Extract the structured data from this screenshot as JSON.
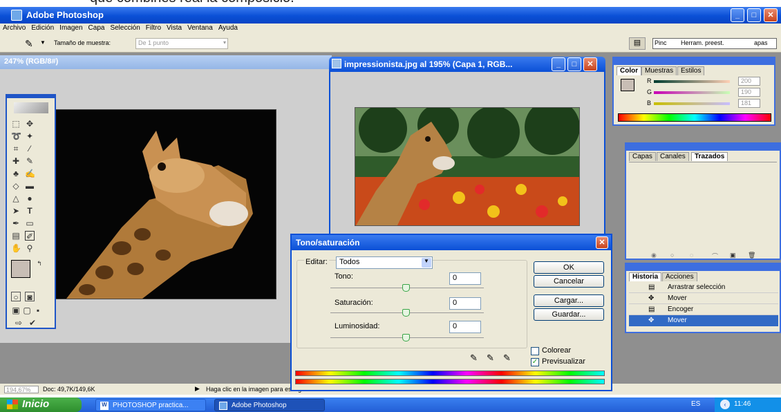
{
  "caption": "que combinés real la composició.",
  "app": {
    "title": "Adobe Photoshop"
  },
  "menu": [
    "Archivo",
    "Edición",
    "Imagen",
    "Capa",
    "Selección",
    "Filtro",
    "Vista",
    "Ventana",
    "Ayuda"
  ],
  "options": {
    "sample_label": "Tamaño de muestra:",
    "sample_value": "De 1 punto",
    "tabs": [
      "Pinc",
      "Herram. preest.",
      "apas"
    ]
  },
  "doc1": {
    "title": "247% (RGB/8#)"
  },
  "doc2": {
    "title": "impressionista.jpg al 195% (Capa 1, RGB..."
  },
  "status": {
    "zoom": "194,67%",
    "doc": "Doc: 49,7K/149,6K",
    "hint": "Haga clic en la imagen para escoger un color nuevo."
  },
  "color_panel": {
    "tabs": [
      "Color",
      "Muestras",
      "Estilos"
    ],
    "channels": [
      {
        "label": "R",
        "value": "200"
      },
      {
        "label": "G",
        "value": "190"
      },
      {
        "label": "B",
        "value": "181"
      }
    ],
    "swatch_color": "#c8beb5"
  },
  "layers_panel": {
    "tabs": [
      "Capas",
      "Canales",
      "Trazados"
    ]
  },
  "history_panel": {
    "tabs": [
      "Historia",
      "Acciones"
    ],
    "items": [
      "Arrastrar selección",
      "Mover",
      "Encoger",
      "Mover"
    ],
    "selected_index": 3
  },
  "dialog": {
    "title": "Tono/saturación",
    "edit_label": "Editar:",
    "edit_value": "Todos",
    "hue_label": "Tono:",
    "hue_value": "0",
    "sat_label": "Saturación:",
    "sat_value": "0",
    "lum_label": "Luminosidad:",
    "lum_value": "0",
    "ok": "OK",
    "cancel": "Cancelar",
    "load": "Cargar...",
    "save": "Guardar...",
    "colorize_label": "Colorear",
    "colorize_checked": false,
    "preview_label": "Previsualizar",
    "preview_checked": true
  },
  "taskbar": {
    "start": "Inicio",
    "tasks": [
      "PHOTOSHOP practica...",
      "Adobe Photoshop"
    ],
    "lang": "ES",
    "time": "11:46"
  },
  "colors": {
    "xp_blue": "#0a4fd6",
    "xp_face": "#ece9d8",
    "workspace": "#8f8f8f",
    "start_green": "#3b9f3a"
  }
}
